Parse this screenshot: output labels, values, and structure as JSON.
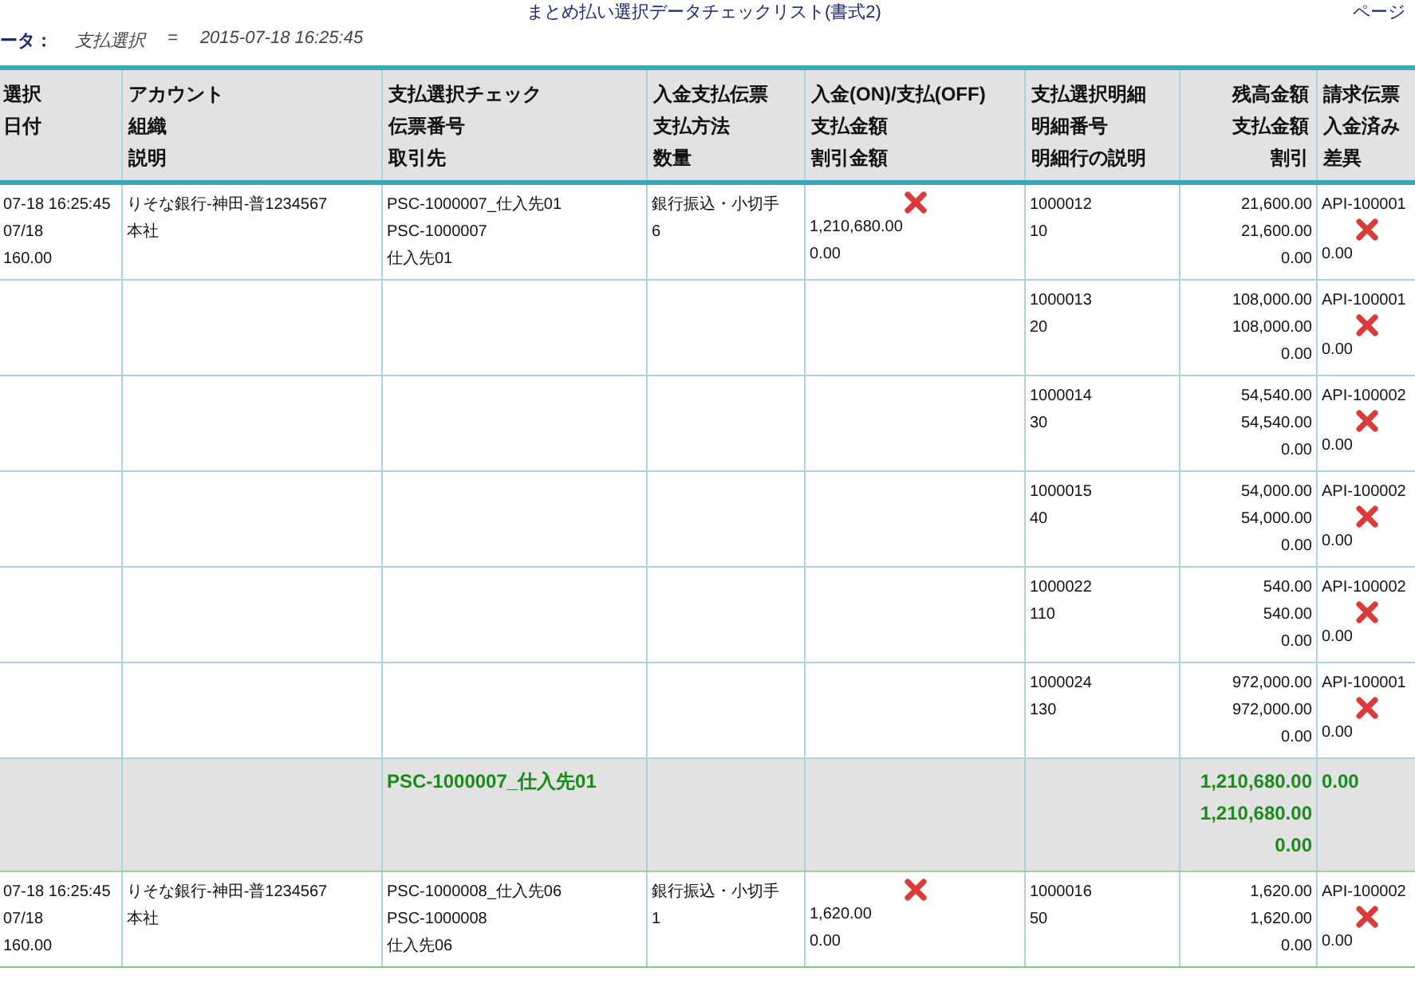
{
  "report": {
    "title": "まとめ払い選択データチェックリスト(書式2)",
    "page_label": "ページ",
    "parameter_label": "ータ：",
    "parameter_name": "支払選択",
    "parameter_operator": "=",
    "parameter_value": "2015-07-18 16:25:45"
  },
  "table": {
    "columns": [
      {
        "lines": [
          "選択",
          "日付"
        ]
      },
      {
        "lines": [
          "アカウント",
          "組織",
          "説明"
        ]
      },
      {
        "lines": [
          "支払選択チェック",
          "伝票番号",
          "取引先"
        ]
      },
      {
        "lines": [
          "入金支払伝票",
          "支払方法",
          "数量"
        ]
      },
      {
        "lines": [
          "入金(ON)/支払(OFF)",
          "支払金額",
          "割引金額"
        ]
      },
      {
        "lines": [
          "支払選択明細",
          "明細番号",
          "明細行の説明"
        ]
      },
      {
        "lines": [
          "残高金額",
          "支払金額",
          "割引"
        ]
      },
      {
        "lines": [
          "請求伝票",
          "入金済み",
          "差異"
        ]
      }
    ],
    "rows": [
      {
        "kind": "detail",
        "cells": [
          [
            "07-18 16:25:45",
            "07/18",
            "160.00"
          ],
          [
            "りそな銀行-神田-普1234567",
            "本社"
          ],
          [
            "PSC-1000007_仕入先01",
            "PSC-1000007",
            "仕入先01"
          ],
          [
            "銀行振込・小切手",
            "6"
          ],
          [
            {
              "checked": false
            },
            "1,210,680.00",
            "0.00"
          ],
          [
            "1000012",
            "10"
          ],
          [
            "21,600.00",
            "21,600.00",
            "0.00"
          ],
          [
            "API-100001",
            {
              "checked": false
            },
            "0.00"
          ]
        ]
      },
      {
        "kind": "detail",
        "cells": [
          null,
          null,
          null,
          null,
          null,
          [
            "1000013",
            "20"
          ],
          [
            "108,000.00",
            "108,000.00",
            "0.00"
          ],
          [
            "API-100001",
            {
              "checked": false
            },
            "0.00"
          ]
        ]
      },
      {
        "kind": "detail",
        "cells": [
          null,
          null,
          null,
          null,
          null,
          [
            "1000014",
            "30"
          ],
          [
            "54,540.00",
            "54,540.00",
            "0.00"
          ],
          [
            "API-100002",
            {
              "checked": false
            },
            "0.00"
          ]
        ]
      },
      {
        "kind": "detail",
        "cells": [
          null,
          null,
          null,
          null,
          null,
          [
            "1000015",
            "40"
          ],
          [
            "54,000.00",
            "54,000.00",
            "0.00"
          ],
          [
            "API-100002",
            {
              "checked": false
            },
            "0.00"
          ]
        ]
      },
      {
        "kind": "detail",
        "cells": [
          null,
          null,
          null,
          null,
          null,
          [
            "1000022",
            "110"
          ],
          [
            "540.00",
            "540.00",
            "0.00"
          ],
          [
            "API-100002",
            {
              "checked": false
            },
            "0.00"
          ]
        ]
      },
      {
        "kind": "detail",
        "cells": [
          null,
          null,
          null,
          null,
          null,
          [
            "1000024",
            "130"
          ],
          [
            "972,000.00",
            "972,000.00",
            "0.00"
          ],
          [
            "API-100001",
            {
              "checked": false
            },
            "0.00"
          ]
        ]
      },
      {
        "kind": "subtotal",
        "cells": [
          null,
          null,
          [
            "PSC-1000007_仕入先01"
          ],
          null,
          null,
          null,
          [
            "1,210,680.00",
            "1,210,680.00",
            "0.00"
          ],
          [
            "0.00"
          ]
        ]
      },
      {
        "kind": "detail",
        "cells": [
          [
            "07-18 16:25:45",
            "07/18",
            "160.00"
          ],
          [
            "りそな銀行-神田-普1234567",
            "本社"
          ],
          [
            "PSC-1000008_仕入先06",
            "PSC-1000008",
            "仕入先06"
          ],
          [
            "銀行振込・小切手",
            "1"
          ],
          [
            {
              "checked": false
            },
            "1,620.00",
            "0.00"
          ],
          [
            "1000016",
            "50"
          ],
          [
            "1,620.00",
            "1,620.00",
            "0.00"
          ],
          [
            "API-100002",
            {
              "checked": false
            },
            "0.00"
          ]
        ]
      }
    ]
  }
}
